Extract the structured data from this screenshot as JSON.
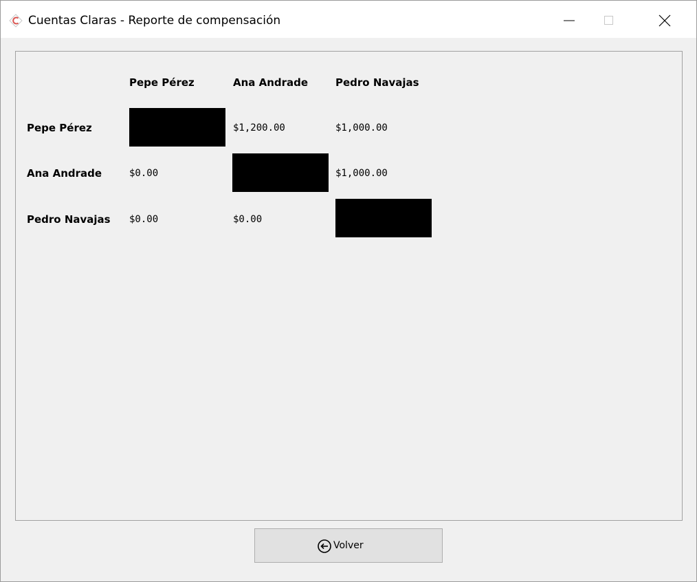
{
  "window": {
    "title": "Cuentas Claras - Reporte de compensación",
    "icons": {
      "app": "cuentas-claras-logo-icon",
      "minimize": "minimize-icon",
      "maximize": "maximize-icon",
      "close": "close-icon"
    }
  },
  "report": {
    "columns": [
      "Pepe Pérez",
      "Ana Andrade",
      "Pedro Navajas"
    ],
    "rows": [
      {
        "name": "Pepe Pérez",
        "cells": [
          null,
          "$1,200.00",
          "$1,000.00"
        ]
      },
      {
        "name": "Ana Andrade",
        "cells": [
          "$0.00",
          null,
          "$1,000.00"
        ]
      },
      {
        "name": "Pedro Navajas",
        "cells": [
          "$0.00",
          "$0.00",
          null
        ]
      }
    ]
  },
  "footer": {
    "back_label": "Volver",
    "back_icon": "arrow-left-circle-icon"
  },
  "colors": {
    "logo_accent": "#d9534f",
    "diagonal_fill": "#000000"
  }
}
